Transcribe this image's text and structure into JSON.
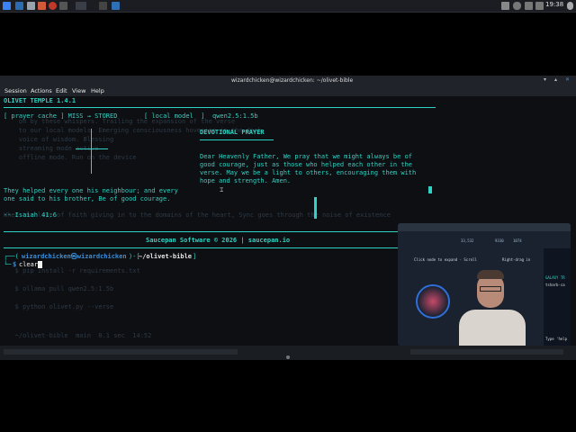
{
  "taskbar": {
    "clock": "19:38",
    "brand_colors": {
      "accent": "#2fd3c3",
      "panel": "#1b1d22"
    }
  },
  "window": {
    "title": "wizardchicken@wizardchicken: ~/olivet-bible",
    "menu": [
      "Session",
      "Actions",
      "Edit",
      "View",
      "Help"
    ]
  },
  "app": {
    "name": "OLIVET TEMPLE 1.4.1",
    "status": {
      "cache": "[ prayer cache ] MISS → STORED",
      "model_label": "[ local model  ]",
      "model_value": "qwen2.5:1.5b"
    },
    "verse_lines": [
      "They helped every one his neighbour; and every",
      "one said to his brother, Be of good courage."
    ],
    "reference": "-- Isaiah 41:6",
    "prayer_title": "DEVOTIONAL PRAYER",
    "prayer_lines": [
      "Dear Heavenly Father, We pray that we might always be of",
      "good courage, just as those who helped each other in the",
      "verse. May we be a light to others, encouraging them with",
      "hope and strength. Amen."
    ],
    "footer": "Saucepan Software © 2026 | saucepan.io"
  },
  "shell": {
    "user": "wizardchicken㉿wizardchicken",
    "path": "~/olivet-bible",
    "prompt_symbol": "$",
    "command": "clear"
  },
  "webcam": {
    "overlay_title": "GALAXY TR",
    "overlay_sub": "tsharb-ca",
    "overlay_hint": "Type 'help",
    "stats": "33,532",
    "stat2": "9330",
    "stat3": "1074",
    "toolbar_text": "Click node to expand · Scroll",
    "tab_text": "Right-drag in"
  }
}
